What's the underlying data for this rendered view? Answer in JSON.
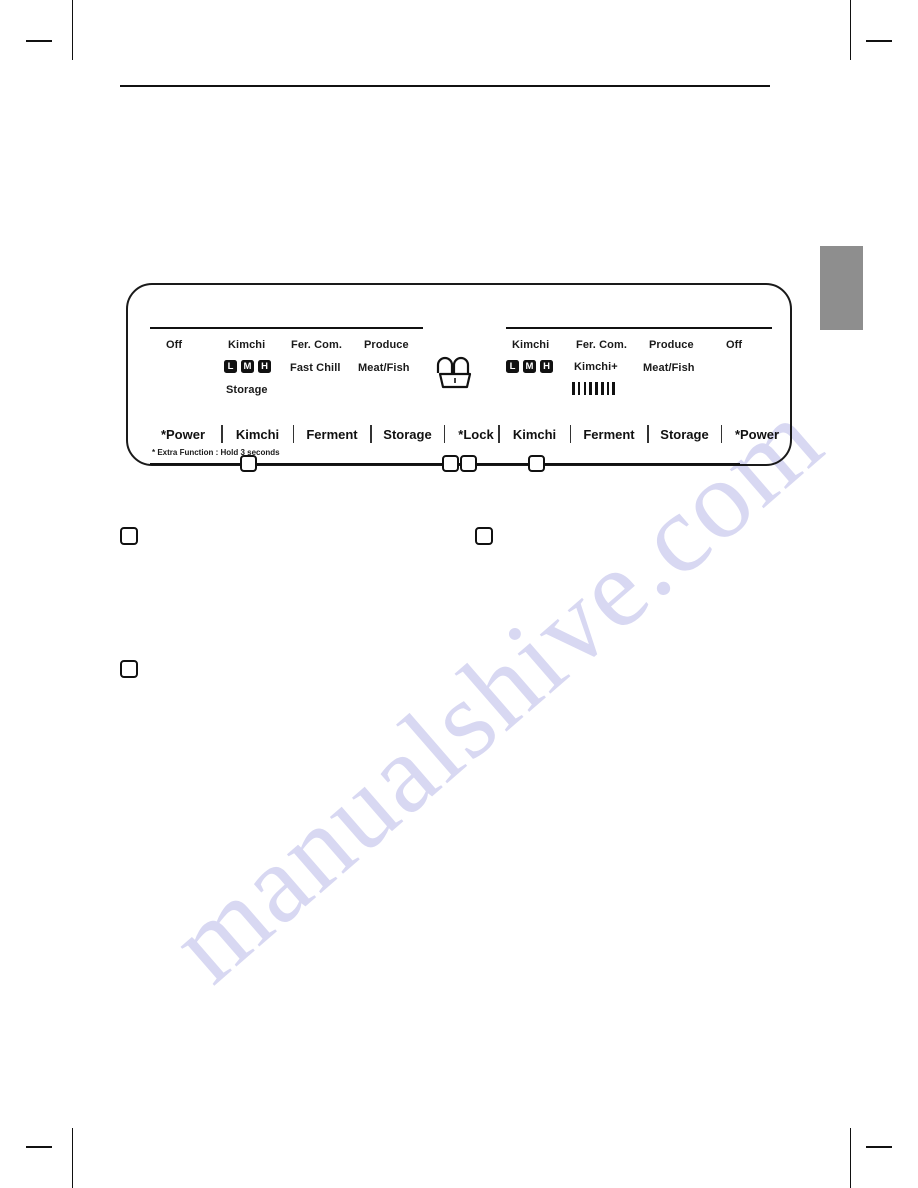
{
  "page": {
    "background_color": "#ffffff",
    "watermark_text": "manualshive.com",
    "watermark_color": "#d8d8f2"
  },
  "crop_marks": {
    "label": "printer-crop-marks"
  },
  "side_tab": {
    "label": "",
    "color": "#8e8e8e"
  },
  "panel": {
    "name": "kimchi-refrigerator-control-panel",
    "left_section": {
      "display_labels_row1": [
        "Off",
        "Kimchi",
        "Fer. Com.",
        "Produce"
      ],
      "display_labels_row2": [
        "Fast Chill",
        "Meat/Fish"
      ],
      "display_labels_row3": [
        "Storage"
      ],
      "level_chips": [
        "L",
        "M",
        "H"
      ],
      "buttons": [
        "*Power",
        "Kimchi",
        "Ferment",
        "Storage",
        "*Lock"
      ],
      "footnote": "* Extra Function : Hold 3 seconds"
    },
    "lock_icon": {
      "name": "lock-icon"
    },
    "right_section": {
      "display_labels_row1": [
        "Kimchi",
        "Fer. Com.",
        "Produce",
        "Off"
      ],
      "display_labels_row2": [
        "Kimchi+",
        "Meat/Fish"
      ],
      "level_chips": [
        "L",
        "M",
        "H"
      ],
      "bar_gauge_count": 8,
      "buttons": [
        "Kimchi",
        "Ferment",
        "Storage",
        "*Power"
      ]
    }
  },
  "callouts": {
    "panel_markers": [
      "",
      "",
      "",
      ""
    ],
    "body_markers": [
      "",
      "",
      ""
    ]
  }
}
